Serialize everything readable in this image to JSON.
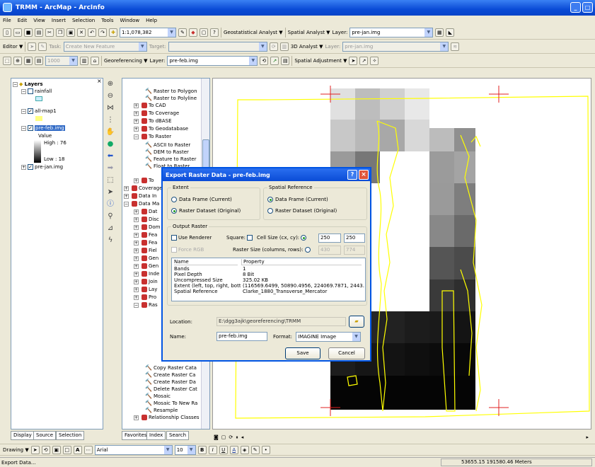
{
  "window": {
    "title": "TRMM - ArcMap - ArcInfo",
    "min": "_",
    "max": "□"
  },
  "menu": [
    "File",
    "Edit",
    "View",
    "Insert",
    "Selection",
    "Tools",
    "Window",
    "Help"
  ],
  "toolbar1": {
    "scale": "1:1,078,382",
    "geostat": "Geostatistical Analyst ▼",
    "spatial": "Spatial Analyst ▼",
    "layer_label": "Layer:",
    "layer_value": "pre-jan.img"
  },
  "toolbar2": {
    "editor": "Editor ▼",
    "task_label": "Task:",
    "task_value": "Create New Feature",
    "target_label": "Target:",
    "analyst3d": "3D Analyst ▼",
    "layer_label": "Layer:",
    "layer_value": "pre-jan.img"
  },
  "toolbar3": {
    "zoom": "1000",
    "georef": "Georeferencing ▼",
    "layer_label": "Layer:",
    "layer_value": "pre-feb.img",
    "spatial_adj": "Spatial Adjustment ▼"
  },
  "toc": {
    "root": "Layers",
    "items": [
      "rainfall",
      "all-map1",
      "pre-feb.img",
      "Value",
      "High : 76",
      "Low : 18",
      "pre-jan.img"
    ]
  },
  "toc_tabs": [
    "Display",
    "Source",
    "Selection"
  ],
  "toolbox": {
    "items": [
      "Raster to Polygon",
      "Raster to Polyline",
      "To CAD",
      "To Coverage",
      "To dBASE",
      "To Geodatabase",
      "To Raster",
      "ASCII to Raster",
      "DEM to Raster",
      "Feature to Raster",
      "Float to Raster",
      "To",
      "Coverage",
      "Data In",
      "Data Ma",
      "Dat",
      "Disc",
      "Dom",
      "Fea",
      "Fea",
      "Fiel",
      "Gen",
      "Gen",
      "Inde",
      "Join",
      "Lay",
      "Pro",
      "Ras",
      "Copy Raster Cata",
      "Create Raster Ca",
      "Create Raster Da",
      "Delete Raster Cat",
      "Mosaic",
      "Mosaic To New Ra",
      "Resample",
      "Relationship Classes"
    ]
  },
  "toolbox_tabs": [
    "Favorites",
    "Index",
    "Search"
  ],
  "dialog": {
    "title": "Export Raster Data - pre-feb.img",
    "help": "?",
    "close": "×",
    "extent": {
      "label": "Extent",
      "opt1": "Data Frame (Current)",
      "opt2": "Raster Dataset (Original)"
    },
    "spatial_ref": {
      "label": "Spatial Reference",
      "opt1": "Data Frame (Current)",
      "opt2": "Raster Dataset (Original)"
    },
    "output": {
      "label": "Output Raster",
      "use_renderer": "Use Renderer",
      "square": "Square:",
      "cell_size": "Cell Size (cx, cy):",
      "cx": "250",
      "cy": "250",
      "force_rgb": "Force RGB",
      "raster_size": "Raster Size (columns, rows):",
      "cols": "430",
      "rows": "774"
    },
    "table": {
      "headers": [
        "Name",
        "Property"
      ],
      "names": [
        "Bands",
        "Pixel Depth",
        "Uncompressed Size",
        "Extent (left, top, right, bott...",
        "Spatial Reference"
      ],
      "props": [
        "1",
        "8 Bit",
        "325.02 KB",
        "(116569.6499, 50890.4956, 224069.7871, 2443...",
        "Clarke_1880_Transverse_Mercator"
      ]
    },
    "location_label": "Location:",
    "location": "E:\\dgg3ajk\\georeferencing\\TRMM",
    "name_label": "Name:",
    "name": "pre-feb.img",
    "format_label": "Format:",
    "format": "IMAGINE Image",
    "save": "Save",
    "cancel": "Cancel"
  },
  "draw_toolbar": {
    "drawing": "Drawing ▼",
    "font": "Arial",
    "size": "10"
  },
  "status": {
    "left": "Export Data...",
    "coords": "53655.15  191580.46 Meters"
  },
  "colors": {
    "xp_blue": "#0a4bd6",
    "map_outline": "#ffff00",
    "cross": "#e02020"
  }
}
